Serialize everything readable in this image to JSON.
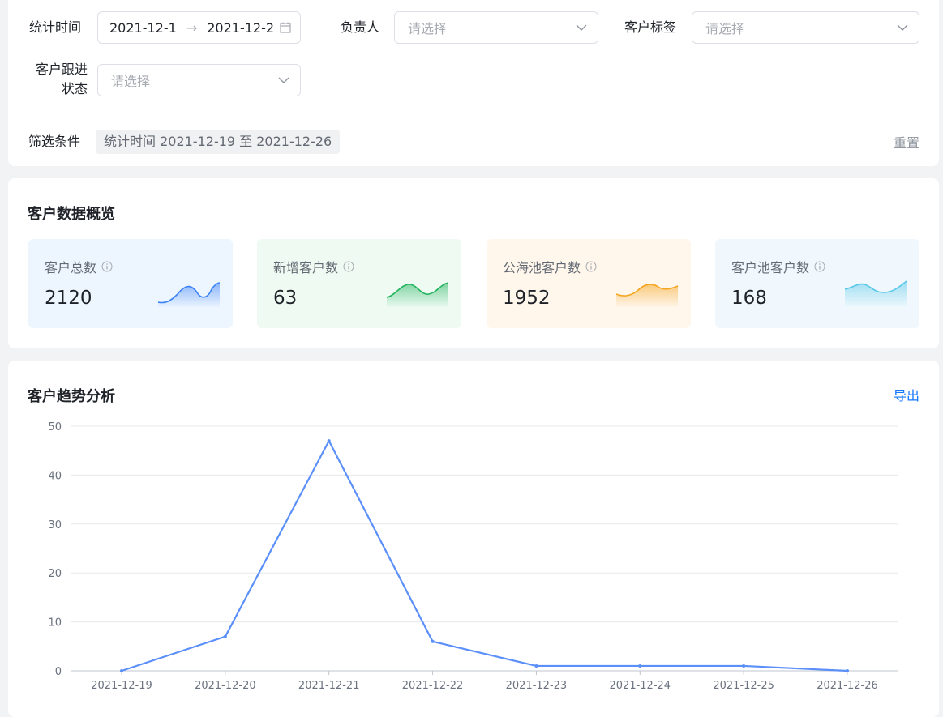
{
  "filters": {
    "stat_time_label": "统计时间",
    "date_start": "2021-12-1",
    "date_end": "2021-12-2",
    "owner_label": "负责人",
    "owner_placeholder": "请选择",
    "tag_label": "客户标签",
    "tag_placeholder": "请选择",
    "status_label_line1": "客户跟进",
    "status_label_line2": "状态",
    "status_placeholder": "请选择",
    "conditions_label": "筛选条件",
    "condition_chip": "统计时间 2021-12-19 至 2021-12-26",
    "reset": "重置"
  },
  "overview": {
    "title": "客户数据概览",
    "cards": [
      {
        "label": "客户总数",
        "value": "2120",
        "color": "#3b82f6",
        "bg": "#edf5ff"
      },
      {
        "label": "新增客户数",
        "value": "63",
        "color": "#22b35e",
        "bg": "#eefaf2"
      },
      {
        "label": "公海池客户数",
        "value": "1952",
        "color": "#f5a623",
        "bg": "#fff6ec"
      },
      {
        "label": "客户池客户数",
        "value": "168",
        "color": "#5ac8e8",
        "bg": "#f0f8fd"
      }
    ]
  },
  "trend": {
    "title": "客户趋势分析",
    "export": "导出"
  },
  "chart_data": {
    "type": "line",
    "categories": [
      "2021-12-19",
      "2021-12-20",
      "2021-12-21",
      "2021-12-22",
      "2021-12-23",
      "2021-12-24",
      "2021-12-25",
      "2021-12-26"
    ],
    "values": [
      0,
      7,
      47,
      6,
      1,
      1,
      1,
      0
    ],
    "ylim": [
      0,
      50
    ],
    "yticks": [
      0,
      10,
      20,
      30,
      40,
      50
    ],
    "color": "#5b8ff9",
    "grid": true
  }
}
